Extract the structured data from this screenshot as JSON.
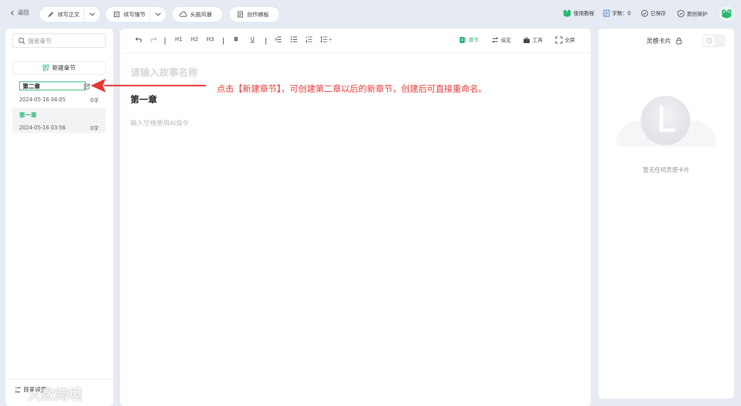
{
  "topbar": {
    "back_label": "返回",
    "continue_text_label": "续写正文",
    "continue_plot_label": "续写情节",
    "brainstorm_label": "头脑风暴",
    "template_label": "创作模板",
    "tutorial_label": "使用教程",
    "word_count_label": "字数：0",
    "saved_label": "已保存",
    "protection_label": "原创保护",
    "accent_color": "#2bb673"
  },
  "sidebar": {
    "search_placeholder": "搜索章节",
    "new_chapter_label": "新建章节",
    "chapters": [
      {
        "name": "第二章",
        "date": "2024-05-16 04:05",
        "count": "0字"
      },
      {
        "name": "第一章",
        "date": "2024-05-16 03:56",
        "count": "0字"
      }
    ],
    "catalog_label": "目录设置"
  },
  "toolbar": {
    "h1": "H1",
    "h2": "H2",
    "h3": "H3",
    "bold": "B",
    "underline": "U",
    "chapter_label": "章节",
    "settings_label": "设定",
    "tools_label": "工具",
    "fullscreen_label": "全屏"
  },
  "editor": {
    "story_title_placeholder": "请输入故事名称",
    "chapter_title": "第一章",
    "ai_hint": "输入空格使用AI指令"
  },
  "annotation": {
    "note": "点击【新建章节】，可创建第二章以后的新章节，创建后可直接重命名。",
    "color": "#e53935"
  },
  "inspiration": {
    "title": "灵感卡片",
    "empty_text": "暂无任何灵感卡片"
  },
  "watermark": {
    "text": "大数跨境"
  }
}
